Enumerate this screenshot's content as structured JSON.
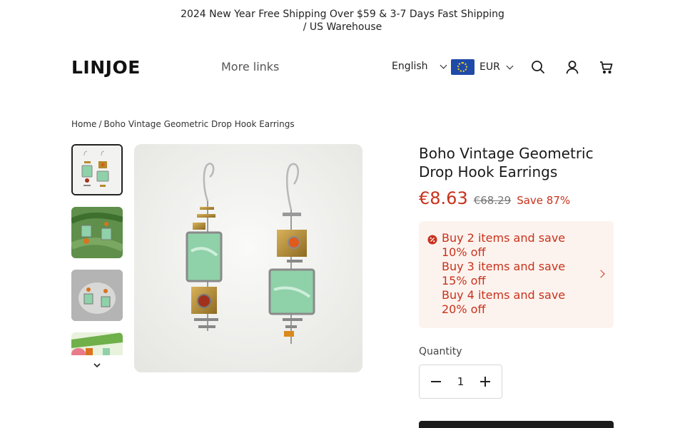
{
  "announcement": {
    "text": "2024 New Year Free Shipping Over $59 & 3-7 Days Fast Shipping / US Warehouse"
  },
  "header": {
    "logo": "LINJOE",
    "more_links": "More links",
    "language": "English",
    "currency": "EUR",
    "icons": [
      "search-icon",
      "account-icon",
      "cart-icon"
    ]
  },
  "breadcrumb": {
    "home": "Home",
    "separator": "/",
    "current": "Boho Vintage Geometric Drop Hook Earrings"
  },
  "product": {
    "title": "Boho Vintage Geometric Drop Hook Earrings",
    "price": "€8.63",
    "compare_price": "€68.29",
    "save_label": "Save 87%",
    "promos": [
      "Buy 2 items and save 10% off",
      "Buy 3 items and save 15% off",
      "Buy 4 items and save 20% off"
    ],
    "quantity_label": "Quantity",
    "quantity_value": "1"
  },
  "colors": {
    "sale_red": "#c8321c",
    "promo_bg": "#fdf3ee",
    "turquoise": "#8fd1a8",
    "gold": "#b48a2c"
  }
}
